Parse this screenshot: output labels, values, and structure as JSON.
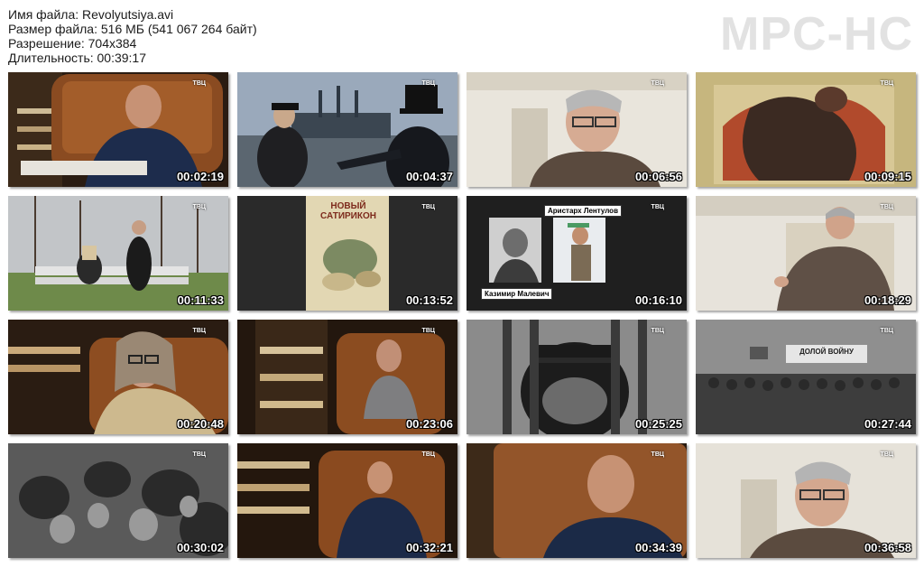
{
  "info": {
    "file_name": "Имя файла: Revolyutsiya.avi",
    "file_size": "Размер файла: 516 МБ (541 067 264 байт)",
    "resolution": "Разрешение: 704x384",
    "duration": "Длительность: 00:39:17"
  },
  "logo": "MPC-HC",
  "channel_logo": "ТВЦ",
  "thumbnails": [
    {
      "time": "00:02:19",
      "scene": "studio-man-chair"
    },
    {
      "time": "00:04:37",
      "scene": "embankment-cruiser"
    },
    {
      "time": "00:06:56",
      "scene": "interview-grey-man"
    },
    {
      "time": "00:09:15",
      "scene": "old-illustration"
    },
    {
      "time": "00:11:33",
      "scene": "park-bench"
    },
    {
      "time": "00:13:52",
      "scene": "satirikon-cover"
    },
    {
      "time": "00:16:10",
      "scene": "two-portraits"
    },
    {
      "time": "00:18:29",
      "scene": "interview-grey-man-wide"
    },
    {
      "time": "00:20:48",
      "scene": "studio-long-hair"
    },
    {
      "time": "00:23:06",
      "scene": "studio-young-man"
    },
    {
      "time": "00:25:25",
      "scene": "ape-in-cage"
    },
    {
      "time": "00:27:44",
      "scene": "crowd-banner"
    },
    {
      "time": "00:30:02",
      "scene": "crowd-closeup"
    },
    {
      "time": "00:32:21",
      "scene": "studio-man-chair-wide"
    },
    {
      "time": "00:34:39",
      "scene": "studio-man-chair-close"
    },
    {
      "time": "00:36:58",
      "scene": "interview-grey-man-2"
    }
  ],
  "satirikon_title": "НОВЫЙ САТИРИКОН",
  "portrait_captions": {
    "lentulov": "Аристарх Лентулов",
    "malevich": "Казимир Малевич"
  },
  "banner_text": "ДОЛОЙ ВОЙНУ"
}
